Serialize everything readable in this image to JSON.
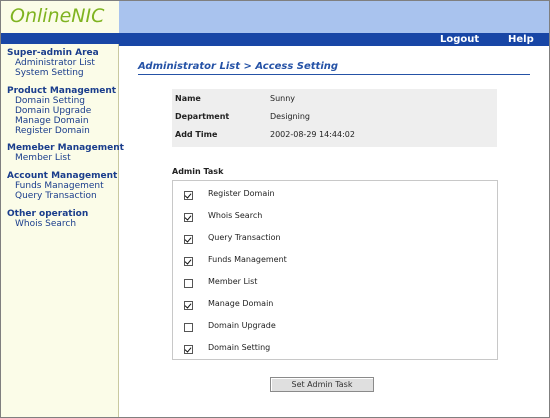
{
  "logo": "OnlineNIC",
  "nav": {
    "logout": "Logout",
    "help": "Help"
  },
  "sidebar": {
    "sections": [
      {
        "title": "Super-admin Area",
        "items": [
          "Administrator List",
          "System Setting"
        ]
      },
      {
        "title": "Product Management",
        "items": [
          "Domain Setting",
          "Domain Upgrade",
          "Manage Domain",
          "Register Domain"
        ]
      },
      {
        "title": "Memeber Management",
        "items": [
          "Member List"
        ]
      },
      {
        "title": "Account Management",
        "items": [
          "Funds Management",
          "Query Transaction"
        ]
      },
      {
        "title": "Other operation",
        "items": [
          "Whois Search"
        ]
      }
    ]
  },
  "main": {
    "title": "Administrator List > Access Setting",
    "info": [
      {
        "label": "Name",
        "value": "Sunny"
      },
      {
        "label": "Department",
        "value": "Designing"
      },
      {
        "label": "Add Time",
        "value": "2002-08-29 14:44:02"
      }
    ],
    "task_heading": "Admin Task",
    "tasks": [
      {
        "label": "Register Domain",
        "checked": true
      },
      {
        "label": "Whois Search",
        "checked": true
      },
      {
        "label": "Query Transaction",
        "checked": true
      },
      {
        "label": "Funds Management",
        "checked": true
      },
      {
        "label": "Member List",
        "checked": false
      },
      {
        "label": "Manage Domain",
        "checked": true
      },
      {
        "label": "Domain Upgrade",
        "checked": false
      },
      {
        "label": "Domain Setting",
        "checked": true
      }
    ],
    "submit_label": "Set Admin Task"
  },
  "colors": {
    "brand_green": "#7fb321",
    "nav_blue": "#1846a6",
    "header_blue": "#a9c3ee",
    "sidebar_bg": "#fbfce8"
  }
}
